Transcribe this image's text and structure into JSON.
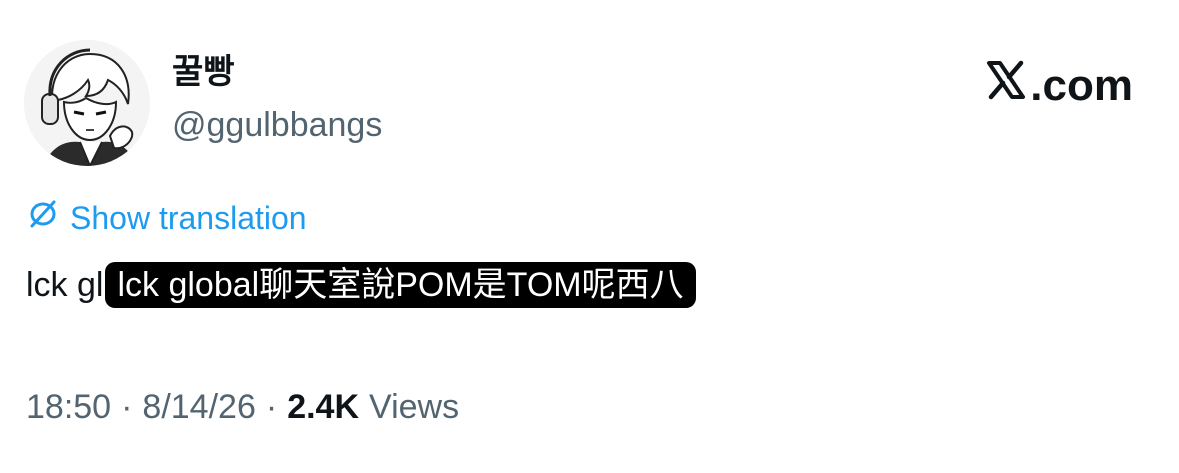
{
  "author": {
    "display_name": "꿀빵",
    "handle": "@ggulbbangs"
  },
  "brand": {
    "label": ".com",
    "icon": "x-logo-icon"
  },
  "translate": {
    "label": "Show translation",
    "icon": "translate-globe-icon",
    "color": "#1d9bf0"
  },
  "tweet": {
    "text": "lck gl",
    "caption": "lck global聊天室說POM是TOM呢西八"
  },
  "meta": {
    "time": "18:50",
    "separator": "·",
    "date": "8/14/26",
    "views_count": "2.4K",
    "views_label": "Views"
  }
}
